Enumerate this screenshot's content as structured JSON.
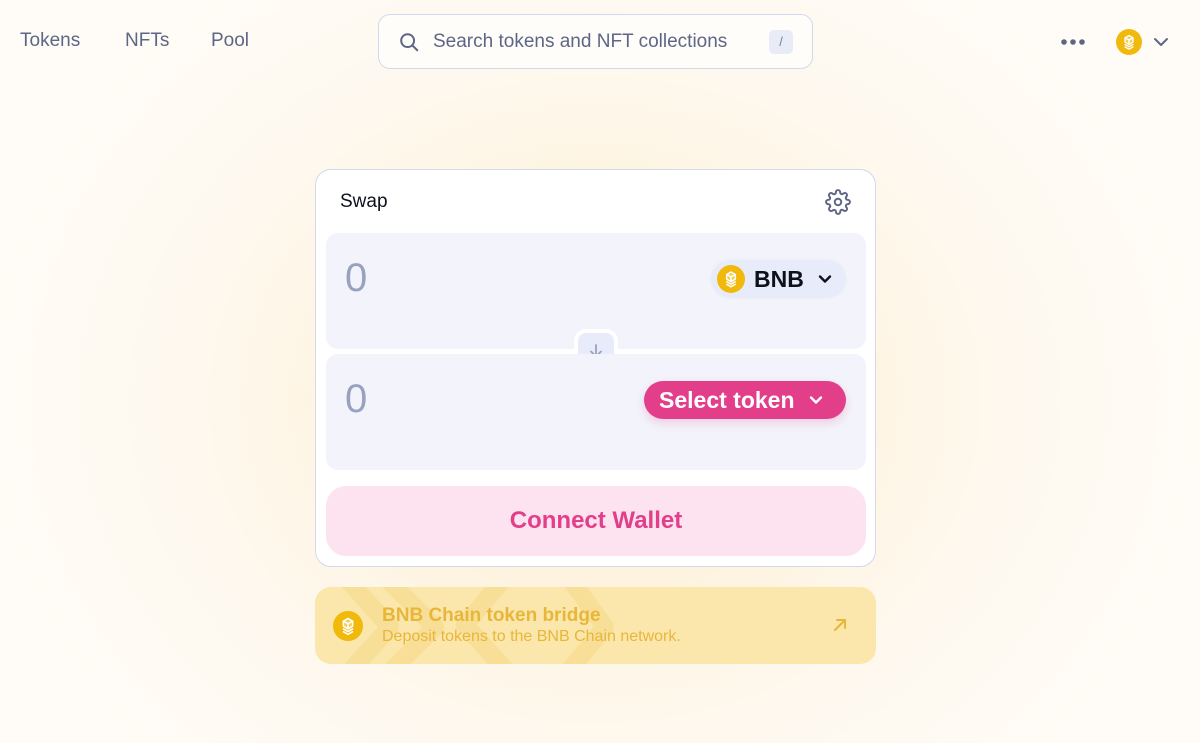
{
  "nav": {
    "links": [
      "Tokens",
      "NFTs",
      "Pool"
    ],
    "search": {
      "placeholder": "Search tokens and NFT collections",
      "shortcut": "/"
    },
    "more_icon": "ellipsis-icon",
    "chain_icon": "bnb-chain-icon"
  },
  "swap": {
    "title": "Swap",
    "from": {
      "amount_placeholder": "0",
      "token_symbol": "BNB"
    },
    "to": {
      "amount_placeholder": "0",
      "select_label": "Select token"
    },
    "connect_label": "Connect Wallet"
  },
  "bridge": {
    "title": "BNB Chain token bridge",
    "subtitle": "Deposit tokens to the BNB Chain network."
  },
  "colors": {
    "accent": "#e23e8a",
    "connect_bg": "#fce3ef",
    "bnb_gold": "#f0b90b",
    "bridge_bg": "#fbe6ab",
    "bridge_text": "#e8b73a",
    "nav_text": "#5d6785"
  }
}
